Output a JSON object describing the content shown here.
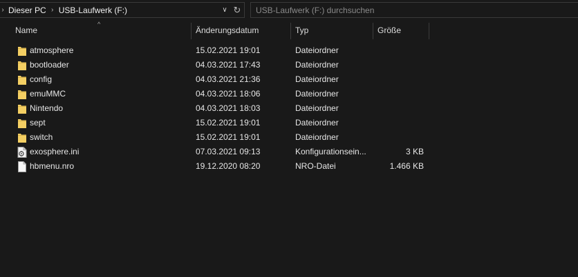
{
  "breadcrumb": {
    "items": [
      {
        "label": "Dieser PC"
      },
      {
        "label": "USB-Laufwerk (F:)"
      }
    ]
  },
  "search": {
    "placeholder": "USB-Laufwerk (F:) durchsuchen"
  },
  "columns": {
    "name": "Name",
    "date": "Änderungsdatum",
    "type": "Typ",
    "size": "Größe"
  },
  "icons": {
    "folder": "folder-icon",
    "ini": "settings-file-icon",
    "file": "file-icon",
    "folder_color": "#f4cf63"
  },
  "files": [
    {
      "name": "atmosphere",
      "date": "15.02.2021 19:01",
      "type": "Dateiordner",
      "size": "",
      "kind": "folder"
    },
    {
      "name": "bootloader",
      "date": "04.03.2021 17:43",
      "type": "Dateiordner",
      "size": "",
      "kind": "folder"
    },
    {
      "name": "config",
      "date": "04.03.2021 21:36",
      "type": "Dateiordner",
      "size": "",
      "kind": "folder"
    },
    {
      "name": "emuMMC",
      "date": "04.03.2021 18:06",
      "type": "Dateiordner",
      "size": "",
      "kind": "folder"
    },
    {
      "name": "Nintendo",
      "date": "04.03.2021 18:03",
      "type": "Dateiordner",
      "size": "",
      "kind": "folder"
    },
    {
      "name": "sept",
      "date": "15.02.2021 19:01",
      "type": "Dateiordner",
      "size": "",
      "kind": "folder"
    },
    {
      "name": "switch",
      "date": "15.02.2021 19:01",
      "type": "Dateiordner",
      "size": "",
      "kind": "folder"
    },
    {
      "name": "exosphere.ini",
      "date": "07.03.2021 09:13",
      "type": "Konfigurationsein...",
      "size": "3 KB",
      "kind": "ini"
    },
    {
      "name": "hbmenu.nro",
      "date": "19.12.2020 08:20",
      "type": "NRO-Datei",
      "size": "1.466 KB",
      "kind": "file"
    }
  ]
}
